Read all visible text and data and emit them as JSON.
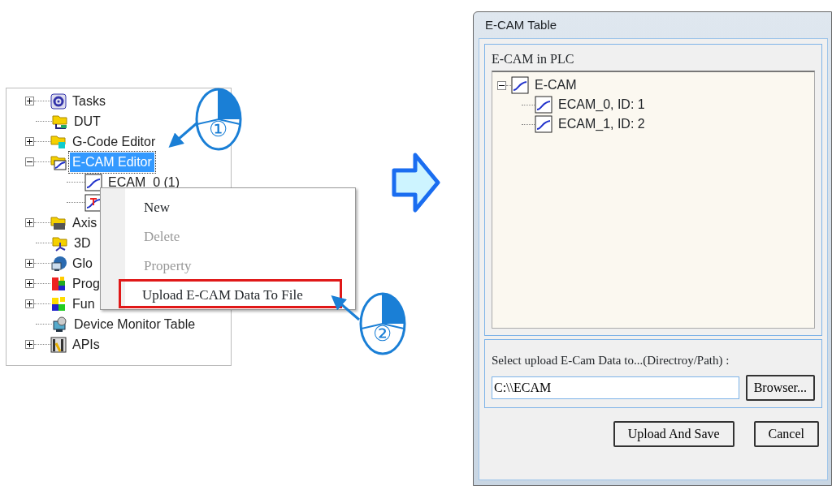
{
  "project_tree": {
    "items": [
      {
        "label": "Tasks",
        "expanded": false,
        "selected": false,
        "highlighted": false
      },
      {
        "label": "DUT",
        "selected": false,
        "highlighted": false
      },
      {
        "label": "G-Code Editor",
        "expanded": false,
        "selected": false,
        "highlighted": false
      },
      {
        "label": "E-CAM Editor",
        "expanded": true,
        "selected": true,
        "highlighted": true,
        "children": [
          {
            "kind": "curve",
            "label": "ECAM_0 (1)"
          },
          {
            "kind": "marked"
          }
        ]
      },
      {
        "label": "Axis",
        "expanded": false,
        "selected": false,
        "highlighted": false
      },
      {
        "label": "3D",
        "selected": false,
        "highlighted": false
      },
      {
        "label": "Glo",
        "expanded": false,
        "selected": false,
        "highlighted": false
      },
      {
        "label": "Prog",
        "expanded": false,
        "selected": false,
        "highlighted": false
      },
      {
        "label": "Fun",
        "expanded": false,
        "selected": false,
        "highlighted": false
      },
      {
        "label": "Device Monitor Table",
        "selected": false,
        "highlighted": false
      },
      {
        "label": "APIs",
        "expanded": false,
        "selected": false,
        "highlighted": false
      }
    ]
  },
  "context_menu": {
    "items": [
      {
        "label": "New",
        "disabled": false,
        "highlighted": false
      },
      {
        "label": "Delete",
        "disabled": true,
        "highlighted": false
      },
      {
        "label": "Property",
        "disabled": true,
        "highlighted": false
      },
      {
        "label": "Upload E-CAM Data To File",
        "disabled": false,
        "highlighted": true
      }
    ]
  },
  "callouts": [
    {
      "number": "①"
    },
    {
      "number": "②"
    }
  ],
  "dialog": {
    "title": "E-CAM Table",
    "group_title": "E-CAM in PLC",
    "tree": {
      "label": "E-CAM",
      "expanded": true,
      "children": [
        {
          "label": "ECAM_0, ID: 1"
        },
        {
          "label": "ECAM_1, ID: 2"
        }
      ]
    },
    "path_label": "Select upload E-Cam Data to...(Directroy/Path) :",
    "path_field": {
      "value": "C:\\\\ECAM"
    },
    "browse_button": "Browser...",
    "buttons": [
      "Upload And Save",
      "Cancel"
    ]
  }
}
